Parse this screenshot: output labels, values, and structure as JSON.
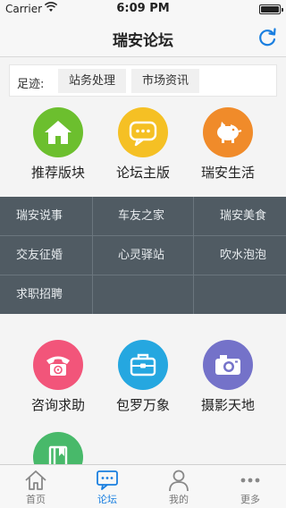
{
  "status_bar": {
    "carrier": "Carrier",
    "time": "6:09 PM"
  },
  "nav": {
    "title": "瑞安论坛"
  },
  "breadcrumb": {
    "label": "足迹:",
    "items": [
      "站务处理",
      "市场资讯"
    ]
  },
  "categories": [
    {
      "label": "推荐版块",
      "color": "#6cbf2e",
      "icon": "home-icon"
    },
    {
      "label": "论坛主版",
      "color": "#f5c024",
      "icon": "chat-bubble-icon"
    },
    {
      "label": "瑞安生活",
      "color": "#f08b2a",
      "icon": "piggy-bank-icon"
    },
    {
      "label": "咨询求助",
      "color": "#f2557a",
      "icon": "telephone-icon"
    },
    {
      "label": "包罗万象",
      "color": "#25a7e0",
      "icon": "briefcase-icon"
    },
    {
      "label": "摄影天地",
      "color": "#7472c9",
      "icon": "camera-icon"
    },
    {
      "label": "",
      "color": "#48b96a",
      "icon": "book-icon"
    }
  ],
  "submenu": {
    "rows": [
      [
        "瑞安说事",
        "车友之家",
        "瑞安美食"
      ],
      [
        "交友征婚",
        "心灵驿站",
        "吹水泡泡"
      ],
      [
        "求职招聘",
        "",
        ""
      ]
    ]
  },
  "tabs": [
    {
      "label": "首页",
      "icon": "home-outline-icon",
      "active": false
    },
    {
      "label": "论坛",
      "icon": "forum-bubble-icon",
      "active": true
    },
    {
      "label": "我的",
      "icon": "person-icon",
      "active": false
    },
    {
      "label": "更多",
      "icon": "more-dots-icon",
      "active": false
    }
  ],
  "colors": {
    "accent": "#1a7fe0",
    "submenu_bg": "#505b63"
  }
}
